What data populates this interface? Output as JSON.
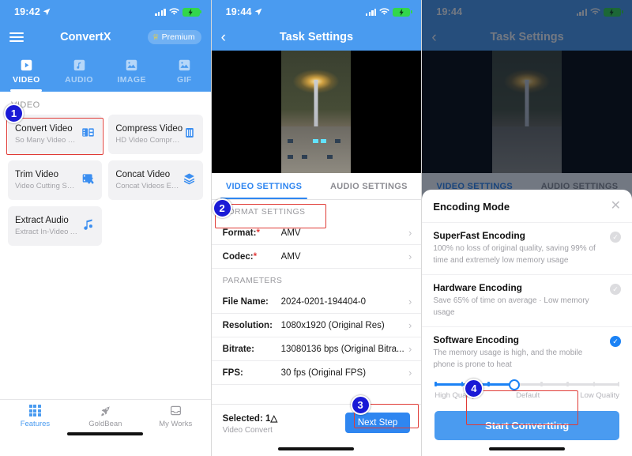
{
  "panel1": {
    "status": {
      "time": "19:42",
      "location_icon": "location-arrow-icon",
      "battery": "battery-charging-icon"
    },
    "nav": {
      "menu_icon": "hamburger-menu-icon",
      "title": "ConvertX",
      "premium_label": "Premium",
      "premium_icon": "crown-icon"
    },
    "tabs": [
      {
        "label": "VIDEO",
        "icon": "video-file-icon",
        "active": true
      },
      {
        "label": "AUDIO",
        "icon": "audio-file-icon",
        "active": false
      },
      {
        "label": "IMAGE",
        "icon": "image-file-icon",
        "active": false
      },
      {
        "label": "GIF",
        "icon": "gif-file-icon",
        "active": false
      }
    ],
    "section_label": "VIDEO",
    "tiles": [
      {
        "title": "Convert Video",
        "subtitle": "So Many Video Form...",
        "icon": "convert-video-icon"
      },
      {
        "title": "Compress Video",
        "subtitle": "HD Video Compress",
        "icon": "compress-video-icon"
      },
      {
        "title": "Trim Video",
        "subtitle": "Video Cutting So Easy",
        "icon": "trim-video-icon"
      },
      {
        "title": "Concat Video",
        "subtitle": "Concat Videos Easily",
        "icon": "concat-video-icon"
      },
      {
        "title": "Extract Audio",
        "subtitle": "Extract In-Video Audio",
        "icon": "music-note-icon"
      }
    ],
    "bottom_nav": [
      {
        "label": "Features",
        "icon": "grid-icon",
        "active": true
      },
      {
        "label": "GoldBean",
        "icon": "rocket-icon",
        "active": false
      },
      {
        "label": "My Works",
        "icon": "inbox-icon",
        "active": false
      }
    ]
  },
  "panel2": {
    "status": {
      "time": "19:44",
      "location_icon": "location-arrow-icon",
      "battery": "battery-charging-icon"
    },
    "nav": {
      "back_icon": "chevron-left-icon",
      "title": "Task Settings"
    },
    "settings_tabs": [
      {
        "label": "VIDEO SETTINGS",
        "active": true
      },
      {
        "label": "AUDIO SETTINGS",
        "active": false
      }
    ],
    "format_section": "FORMAT SETTINGS",
    "format_rows": [
      {
        "key": "Format:",
        "required": "*",
        "value": "AMV"
      },
      {
        "key": "Codec:",
        "required": "*",
        "value": "AMV"
      }
    ],
    "parameters_section": "PARAMETERS",
    "parameter_rows": [
      {
        "key": "File Name:",
        "value": "2024-0201-194404-0"
      },
      {
        "key": "Resolution:",
        "value": "1080x1920 (Original Res)"
      },
      {
        "key": "Bitrate:",
        "value": "13080136 bps (Original Bitra..."
      },
      {
        "key": "FPS:",
        "value": "30 fps (Original FPS)"
      }
    ],
    "footer": {
      "selected_label": "Selected:",
      "selected_count": "1△",
      "task_type": "Video Convert",
      "next_label": "Next Step"
    }
  },
  "panel3": {
    "status": {
      "time": "19:44",
      "battery": "battery-charging-icon"
    },
    "nav": {
      "back_icon": "chevron-left-icon",
      "title": "Task Settings"
    },
    "settings_tabs": [
      {
        "label": "VIDEO SETTINGS",
        "active": true
      },
      {
        "label": "AUDIO SETTINGS",
        "active": false
      }
    ],
    "sheet": {
      "title": "Encoding Mode",
      "close_icon": "close-icon",
      "options": [
        {
          "title": "SuperFast Encoding",
          "desc": "100% no loss of original quality, saving 99% of time and extremely low memory usage",
          "selected": false
        },
        {
          "title": "Hardware Encoding",
          "desc": "Save 65% of time on average · Low memory usage",
          "selected": false
        },
        {
          "title": "Software Encoding",
          "desc": "The memory usage is high, and the mobile phone is prone to heat",
          "selected": true
        }
      ],
      "slider": {
        "value_pct": 43,
        "left_label": "High Quality",
        "mid_label": "Default",
        "right_label": "Low Quality"
      },
      "start_label": "Start Convertting"
    }
  },
  "annotations": [
    {
      "number": "1"
    },
    {
      "number": "2"
    },
    {
      "number": "3"
    },
    {
      "number": "4"
    }
  ],
  "colors": {
    "brand_blue": "#4a9bf0",
    "accent_blue": "#2f86f0",
    "highlight_red": "#e03b36",
    "badge_blue": "#1a1ad6"
  }
}
